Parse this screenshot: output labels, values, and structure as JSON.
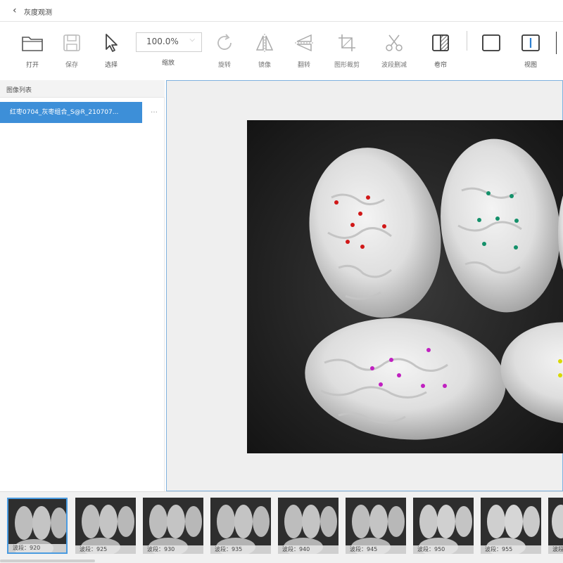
{
  "window": {
    "title": "灰度观测"
  },
  "toolbar": {
    "tools": [
      {
        "id": "open",
        "label": "打开",
        "icon": "folder-icon",
        "enabled": true
      },
      {
        "id": "save",
        "label": "保存",
        "icon": "save-icon",
        "enabled": false
      },
      {
        "id": "select",
        "label": "选择",
        "icon": "cursor-icon",
        "enabled": true
      },
      {
        "id": "rotate",
        "label": "旋转",
        "icon": "rotate-icon",
        "enabled": false
      },
      {
        "id": "mirror",
        "label": "镜像",
        "icon": "mirror-icon",
        "enabled": false
      },
      {
        "id": "flip",
        "label": "翻转",
        "icon": "flip-icon",
        "enabled": false
      },
      {
        "id": "crop",
        "label": "图形裁剪",
        "icon": "crop-icon",
        "enabled": false
      },
      {
        "id": "band-cut",
        "label": "波段删减",
        "icon": "scissors-icon",
        "enabled": false
      },
      {
        "id": "roll",
        "label": "卷帘",
        "icon": "curtain-icon",
        "enabled": true
      },
      {
        "id": "view-single",
        "label": "",
        "icon": "single-view-icon",
        "enabled": true
      },
      {
        "id": "view",
        "label": "视图",
        "icon": "split-view-icon",
        "enabled": true
      }
    ],
    "zoom": {
      "value": "100.0%",
      "label": "缩放"
    }
  },
  "image_list": {
    "header": "图像列表",
    "items": [
      {
        "name": "红枣0704_灰枣组合_S@R_210707...",
        "selected": true
      }
    ],
    "more": "…"
  },
  "canvas": {
    "groups": [
      {
        "color": "#d01818",
        "points": 7
      },
      {
        "color": "#14906a",
        "points": 7
      },
      {
        "color": "#c020c0",
        "points": 7
      },
      {
        "color": "#d8d800",
        "points": 2
      }
    ]
  },
  "filmstrip": {
    "thumbnails": [
      {
        "label": "波段：920",
        "selected": true
      },
      {
        "label": "波段：925",
        "selected": false
      },
      {
        "label": "波段：930",
        "selected": false
      },
      {
        "label": "波段：935",
        "selected": false
      },
      {
        "label": "波段：940",
        "selected": false
      },
      {
        "label": "波段：945",
        "selected": false
      },
      {
        "label": "波段：950",
        "selected": false
      },
      {
        "label": "波段：955",
        "selected": false
      },
      {
        "label": "波段：",
        "selected": false
      }
    ]
  }
}
